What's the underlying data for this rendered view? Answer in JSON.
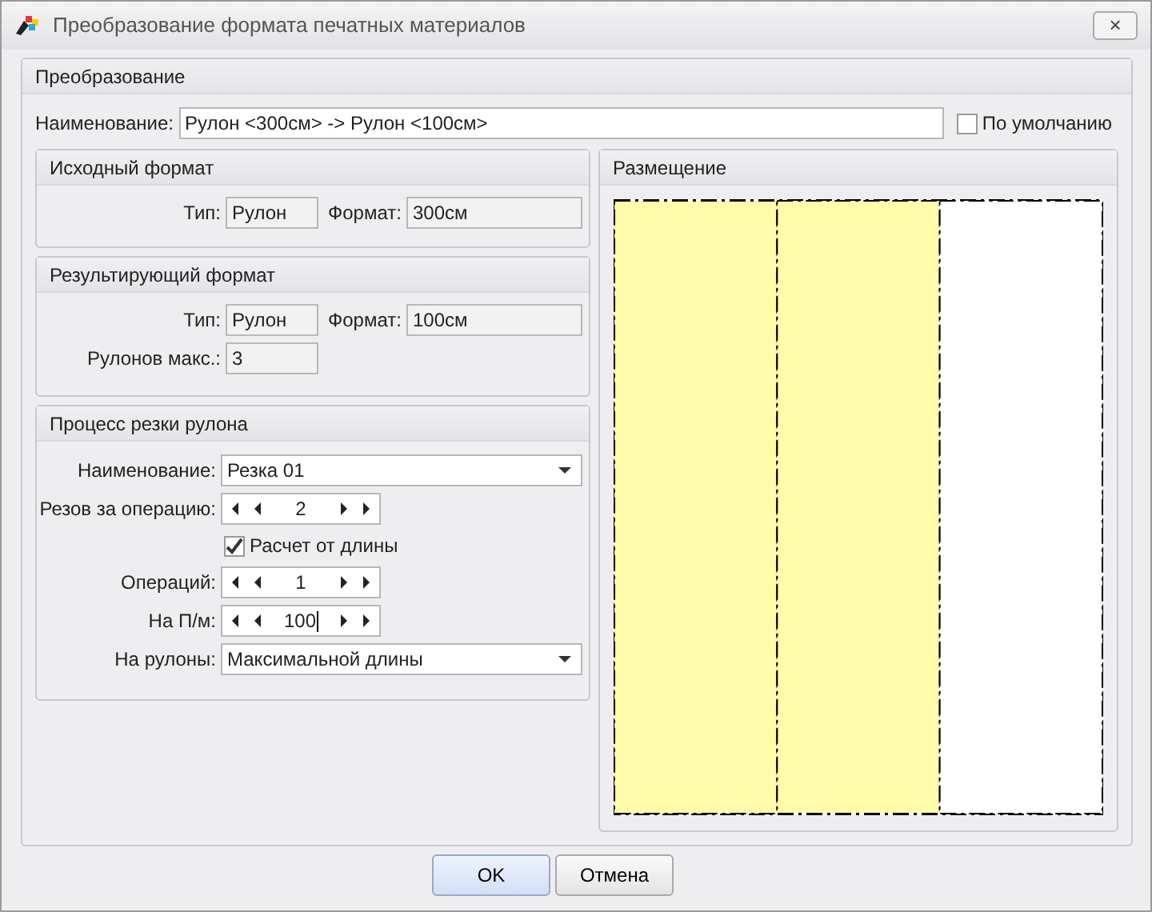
{
  "window": {
    "title": "Преобразование формата печатных материалов",
    "close": "×"
  },
  "group": {
    "title": "Преобразование",
    "name_label": "Наименование:",
    "name_value": "Рулон <300см> -> Рулон <100см>",
    "default_label": "По умолчанию",
    "default_checked": false
  },
  "source": {
    "title": "Исходный формат",
    "type_label": "Тип:",
    "type_value": "Рулон",
    "format_label": "Формат:",
    "format_value": "300см"
  },
  "result": {
    "title": "Результирующий формат",
    "type_label": "Тип:",
    "type_value": "Рулон",
    "format_label": "Формат:",
    "format_value": "100см",
    "max_label": "Рулонов макс.:",
    "max_value": "3"
  },
  "cutting": {
    "title": "Процесс резки рулона",
    "rows": [
      {
        "kind": "combo",
        "label": "Наименование:",
        "value": "Резка 01"
      },
      {
        "kind": "spin",
        "label": "Резов за операцию:",
        "value": "2"
      },
      {
        "kind": "checkbox",
        "label": "Расчет от длины",
        "checked": true
      },
      {
        "kind": "spin",
        "label": "Операций:",
        "value": "1"
      },
      {
        "kind": "spin",
        "label": "На П/м:",
        "value": "100",
        "focused": true
      },
      {
        "kind": "combo",
        "label": "На рулоны:",
        "value": "Максимальной длины"
      }
    ]
  },
  "placement": {
    "title": "Размещение",
    "strips": [
      {
        "filled": true
      },
      {
        "filled": true
      },
      {
        "filled": false
      }
    ]
  },
  "buttons": [
    {
      "label": "OK",
      "default": true
    },
    {
      "label": "Отмена",
      "default": false
    }
  ]
}
